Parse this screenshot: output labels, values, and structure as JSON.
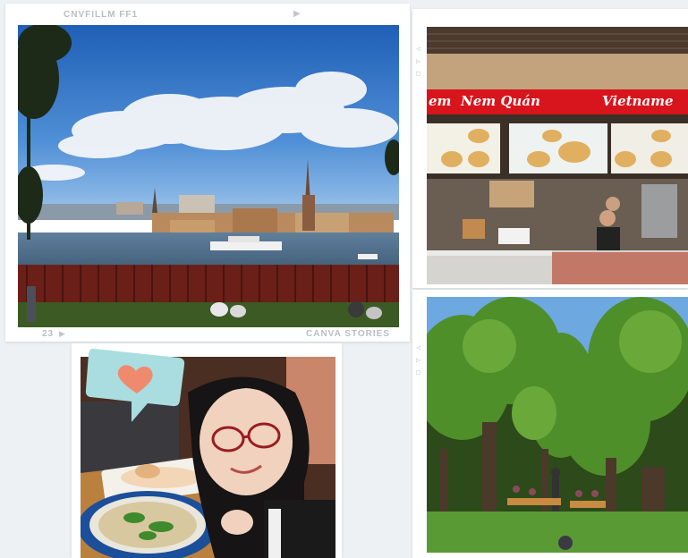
{
  "collage": {
    "colors": {
      "background": "#eef1f3",
      "frame": "#ffffff",
      "film_text": "#b9bec3",
      "accent_heart": "#f08a6e",
      "speech_bubble": "#a9dde0"
    },
    "frame_top_left": {
      "label_top": "CNVFILLM FF1",
      "label_bottom_left": "23",
      "label_bottom_right": "CANVA STORIES",
      "photo": "stockholm-riddarholmen-view"
    },
    "frame_top_right": {
      "photo": "vietnamese-restaurant-counter",
      "sign_left": "em",
      "sign_name": "Nem Quán",
      "sign_right": "Vietname"
    },
    "frame_bottom_left": {
      "photo": "selfie-with-pho",
      "sticker_icon": "heart-speech-bubble-icon"
    },
    "frame_bottom_right": {
      "photo": "park-trees-outdoor-cafe"
    }
  }
}
